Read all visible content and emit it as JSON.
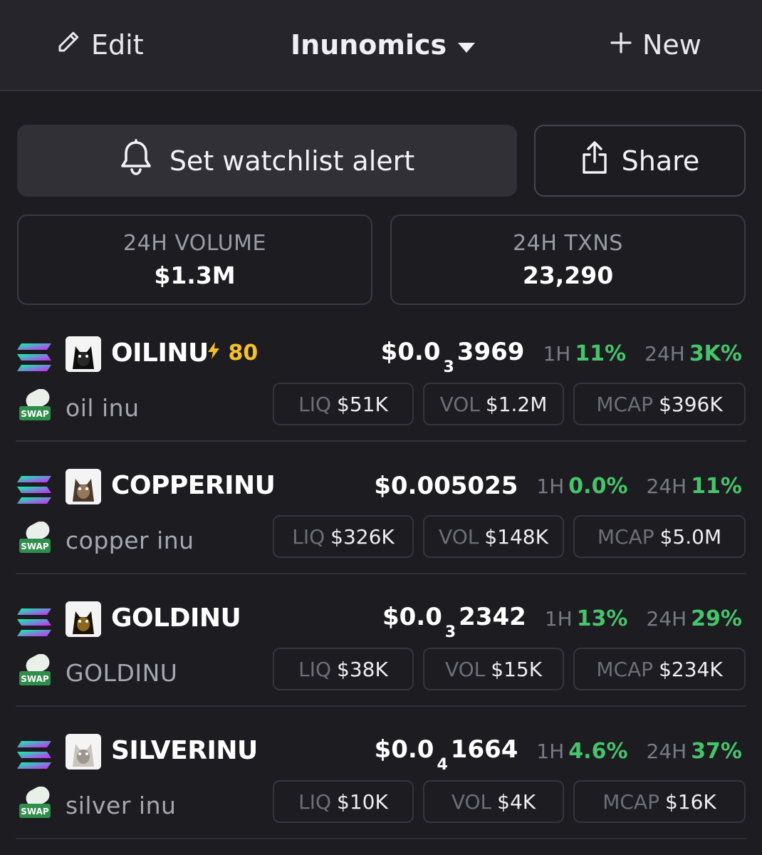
{
  "header": {
    "edit_label": "Edit",
    "title": "Inunomics",
    "new_label": "New"
  },
  "actions": {
    "alert_label": "Set watchlist alert",
    "share_label": "Share"
  },
  "stats": {
    "volume_label": "24H VOLUME",
    "volume_value": "$1.3M",
    "txns_label": "24H TXNS",
    "txns_value": "23,290"
  },
  "colors": {
    "positive": "#46c46a",
    "boost": "#f5c027",
    "background": "#1c1c21"
  },
  "tokens": [
    {
      "symbol": "OILINU",
      "boost": "80",
      "name": "oil inu",
      "price_main": "$0.0",
      "price_sub": "3",
      "price_tail": "3969",
      "h1_label": "1H",
      "h1": "11%",
      "h24_label": "24H",
      "h24": "3K%",
      "liq_label": "LIQ",
      "liq": "$51K",
      "vol_label": "VOL",
      "vol": "$1.2M",
      "mcap_label": "MCAP",
      "mcap": "$396K",
      "chain_icon": "solana-icon",
      "dex_icon": "swap-dex-icon"
    },
    {
      "symbol": "COPPERINU",
      "name": "copper inu",
      "price_main": "$0.005025",
      "h1_label": "1H",
      "h1": "0.0%",
      "h24_label": "24H",
      "h24": "11%",
      "liq_label": "LIQ",
      "liq": "$326K",
      "vol_label": "VOL",
      "vol": "$148K",
      "mcap_label": "MCAP",
      "mcap": "$5.0M",
      "chain_icon": "solana-icon",
      "dex_icon": "swap-dex-icon"
    },
    {
      "symbol": "GOLDINU",
      "name": "GOLDINU",
      "price_main": "$0.0",
      "price_sub": "3",
      "price_tail": "2342",
      "h1_label": "1H",
      "h1": "13%",
      "h24_label": "24H",
      "h24": "29%",
      "liq_label": "LIQ",
      "liq": "$38K",
      "vol_label": "VOL",
      "vol": "$15K",
      "mcap_label": "MCAP",
      "mcap": "$234K",
      "chain_icon": "solana-icon",
      "dex_icon": "swap-dex-icon"
    },
    {
      "symbol": "SILVERINU",
      "name": "silver inu",
      "price_main": "$0.0",
      "price_sub": "4",
      "price_tail": "1664",
      "h1_label": "1H",
      "h1": "4.6%",
      "h24_label": "24H",
      "h24": "37%",
      "liq_label": "LIQ",
      "liq": "$10K",
      "vol_label": "VOL",
      "vol": "$4K",
      "mcap_label": "MCAP",
      "mcap": "$16K",
      "chain_icon": "solana-icon",
      "dex_icon": "swap-dex-icon"
    }
  ],
  "dex_badge_text": "SWAP"
}
